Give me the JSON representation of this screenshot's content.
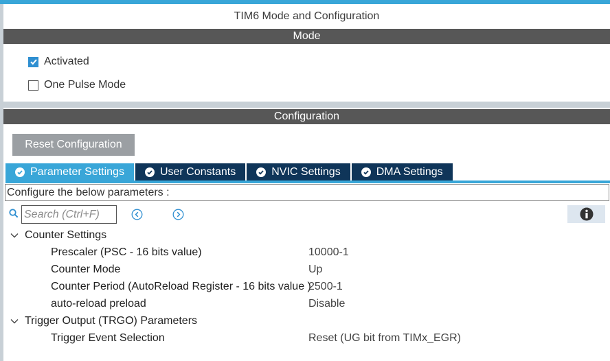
{
  "window": {
    "title": "TIM6 Mode and Configuration"
  },
  "mode": {
    "header": "Mode",
    "activated": {
      "label": "Activated",
      "checked": true
    },
    "one_pulse": {
      "label": "One Pulse Mode",
      "checked": false
    }
  },
  "configuration": {
    "header": "Configuration",
    "reset_label": "Reset Configuration",
    "tabs": [
      {
        "label": "Parameter Settings",
        "active": true
      },
      {
        "label": "User Constants",
        "active": false
      },
      {
        "label": "NVIC Settings",
        "active": false
      },
      {
        "label": "DMA Settings",
        "active": false
      }
    ],
    "description": "Configure the below parameters :",
    "search": {
      "placeholder": "Search (Ctrl+F)",
      "value": ""
    },
    "groups": [
      {
        "title": "Counter Settings",
        "params": [
          {
            "label": "Prescaler (PSC - 16 bits value)",
            "value": "10000-1"
          },
          {
            "label": "Counter Mode",
            "value": "Up"
          },
          {
            "label": "Counter Period (AutoReload Register - 16 bits value )",
            "value": "2500-1"
          },
          {
            "label": "auto-reload preload",
            "value": "Disable"
          }
        ]
      },
      {
        "title": "Trigger Output (TRGO) Parameters",
        "params": [
          {
            "label": "Trigger Event Selection",
            "value": "Reset (UG bit from TIMx_EGR)"
          }
        ]
      }
    ]
  },
  "colors": {
    "accent": "#39a6d8",
    "tab_inactive": "#0f3559",
    "section_header": "#575757",
    "checkbox_checked": "#2f8fd1",
    "reset_button": "#9b9fa3"
  },
  "icons": {
    "search": "search-icon",
    "prev": "chevron-left-circle-icon",
    "next": "chevron-right-circle-icon",
    "info": "info-icon",
    "tab_status": "check-circle-icon",
    "group_toggle": "chevron-down-icon"
  }
}
